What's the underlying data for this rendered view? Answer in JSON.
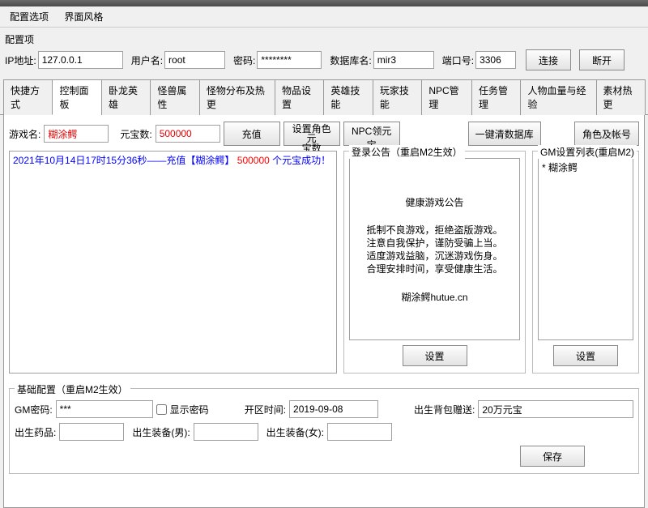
{
  "menu": {
    "config_options": "配置选项",
    "ui_style": "界面风格"
  },
  "config_header": "配置项",
  "conn": {
    "ip_label": "IP地址:",
    "ip_value": "127.0.0.1",
    "user_label": "用户名:",
    "user_value": "root",
    "pwd_label": "密码:",
    "pwd_value": "********",
    "db_label": "数据库名:",
    "db_value": "mir3",
    "port_label": "端口号:",
    "port_value": "3306",
    "connect_btn": "连接",
    "disconnect_btn": "断开"
  },
  "tabs": [
    "快捷方式",
    "控制面板",
    "卧龙英雄",
    "怪兽属性",
    "怪物分布及热更",
    "物品设置",
    "英雄技能",
    "玩家技能",
    "NPC管理",
    "任务管理",
    "人物血量与经验",
    "素材热更"
  ],
  "active_tab": 1,
  "panel": {
    "game_name_label": "游戏名:",
    "game_name_value": "糊涂鳄",
    "yuanbao_label": "元宝数:",
    "yuanbao_value": "500000",
    "recharge_btn": "充值",
    "set_role_btn_line1": "设置角色元",
    "set_role_btn_line2": "宝数",
    "npc_yuanbao_btn": "NPC领元宝",
    "clear_db_btn": "一键清数据库",
    "role_account_btn": "角色及帐号"
  },
  "log": {
    "part1": "2021年10月14日17时15分36秒——充值【糊涂鳄】",
    "part2": " 500000 ",
    "part3": "个元宝成功！"
  },
  "login_notice": {
    "legend": "登录公告（重启M2生效）",
    "title": "健康游戏公告",
    "l1": "抵制不良游戏，拒绝盗版游戏。",
    "l2": "注意自我保护，谨防受骗上当。",
    "l3": "适度游戏益脑，沉迷游戏伤身。",
    "l4": "合理安排时间，享受健康生活。",
    "footer": "糊涂鳄hutue.cn",
    "set_btn": "设置"
  },
  "gm": {
    "legend": "GM设置列表(重启M2)",
    "item": "* 糊涂鳄",
    "set_btn": "设置"
  },
  "basic": {
    "legend": "基础配置（重启M2生效）",
    "gm_pwd_label": "GM密码:",
    "gm_pwd_value": "***",
    "show_pwd_label": "显示密码",
    "open_time_label": "开区时间:",
    "open_time_value": "2019-09-08",
    "birth_bag_label": "出生背包赠送:",
    "birth_bag_value": "20万元宝",
    "birth_med_label": "出生药品:",
    "birth_equip_m_label": "出生装备(男):",
    "birth_equip_f_label": "出生装备(女):",
    "save_btn": "保存"
  }
}
